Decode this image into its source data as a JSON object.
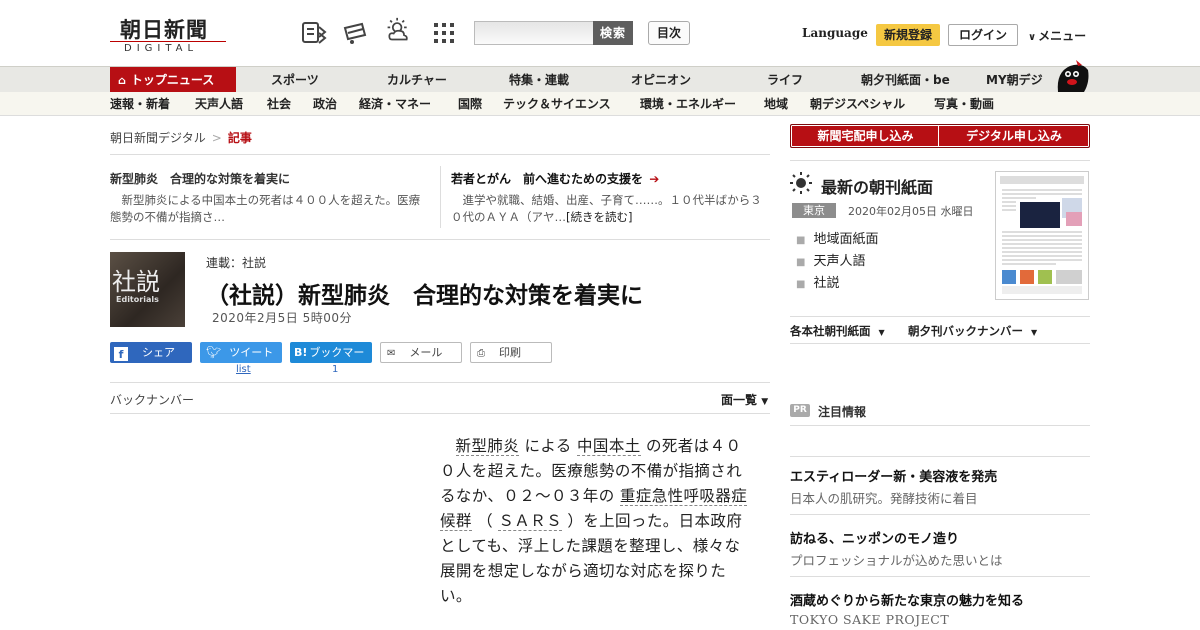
{
  "header": {
    "logo_main": "朝日新聞",
    "logo_sub": "DIGITAL",
    "search_button": "検索",
    "toc_button": "目次",
    "language": "Language",
    "register": "新規登録",
    "login": "ログイン",
    "menu": "メニュー"
  },
  "nav_primary": [
    "トップニュース",
    "スポーツ",
    "カルチャー",
    "特集・連載",
    "オピニオン",
    "ライフ",
    "朝夕刊紙面・be",
    "MY朝デジ"
  ],
  "nav_secondary": [
    "速報・新着",
    "天声人語",
    "社会",
    "政治",
    "経済・マネー",
    "国際",
    "テック＆サイエンス",
    "環境・エネルギー",
    "地域",
    "朝デジスペシャル",
    "写真・動画"
  ],
  "breadcrumb": {
    "home": "朝日新聞デジタル",
    "sep": ">",
    "current": "記事"
  },
  "related": [
    {
      "title": "新型肺炎　合理的な対策を着実に",
      "desc": "新型肺炎による中国本土の死者は４００人を超えた。医療態勢の不備が指摘さ…"
    },
    {
      "title": "若者とがん　前へ進むための支援を",
      "arrow": "➔",
      "desc": "進学や就職、結婚、出産、子育て……。１０代半ばから３０代のＡＹＡ（アヤ…",
      "more": "[続きを読む]"
    }
  ],
  "article": {
    "thumb_kanji": "社説",
    "thumb_en": "Editorials",
    "series": "連載：社説",
    "headline": "（社説）新型肺炎　合理的な対策を着実に",
    "date": "2020年2月5日 5時00分",
    "body": {
      "p1": "新型肺炎",
      "p2": "による",
      "p3": "中国本土",
      "p4": "の死者は４００人を超えた。医療態勢の不備が指摘されるなか、０２～０３年の",
      "p5": "重症急性呼吸器症候群",
      "p6": "（",
      "p7": "ＳＡＲＳ",
      "p8": "）を上回った。日本政府としても、浮上した課題を整理し、様々な展開を想定しながら適切な対応を探りたい。"
    }
  },
  "share": {
    "facebook": "シェア",
    "twitter": "ツイート",
    "twitter_count": "list",
    "hatena": "ブックマーク",
    "hatena_count": "1",
    "mail": "メール",
    "print": "印刷"
  },
  "backnumber": "バックナンバー",
  "page_list": "面一覧",
  "sidebar": {
    "subscribe_paper": "新聞宅配申し込み",
    "subscribe_digital": "デジタル申し込み",
    "paper_title": "最新の朝刊紙面",
    "region": "東京",
    "paper_date": "2020年02月05日 水曜日",
    "links": [
      "地域面紙面",
      "天声人語",
      "社説"
    ],
    "dropdown1": "各本社朝刊紙面",
    "dropdown2": "朝夕刊バックナンバー",
    "pr_badge": "PR",
    "pr_title": "注目情報",
    "ads": [
      {
        "title": "エスティローダー新・美容液を発売",
        "sub": "日本人の肌研究。発酵技術に着目"
      },
      {
        "title": "訪ねる、ニッポンのモノ造り",
        "sub": "プロフェッショナルが込めた思いとは"
      },
      {
        "title": "酒蔵めぐりから新たな東京の魅力を知る",
        "sub": "TOKYO SAKE PROJECT"
      }
    ]
  },
  "colors": {
    "brand_red": "#b70f14",
    "register_yellow": "#f5c842",
    "facebook": "#2f67bd",
    "twitter": "#3c98e8"
  }
}
